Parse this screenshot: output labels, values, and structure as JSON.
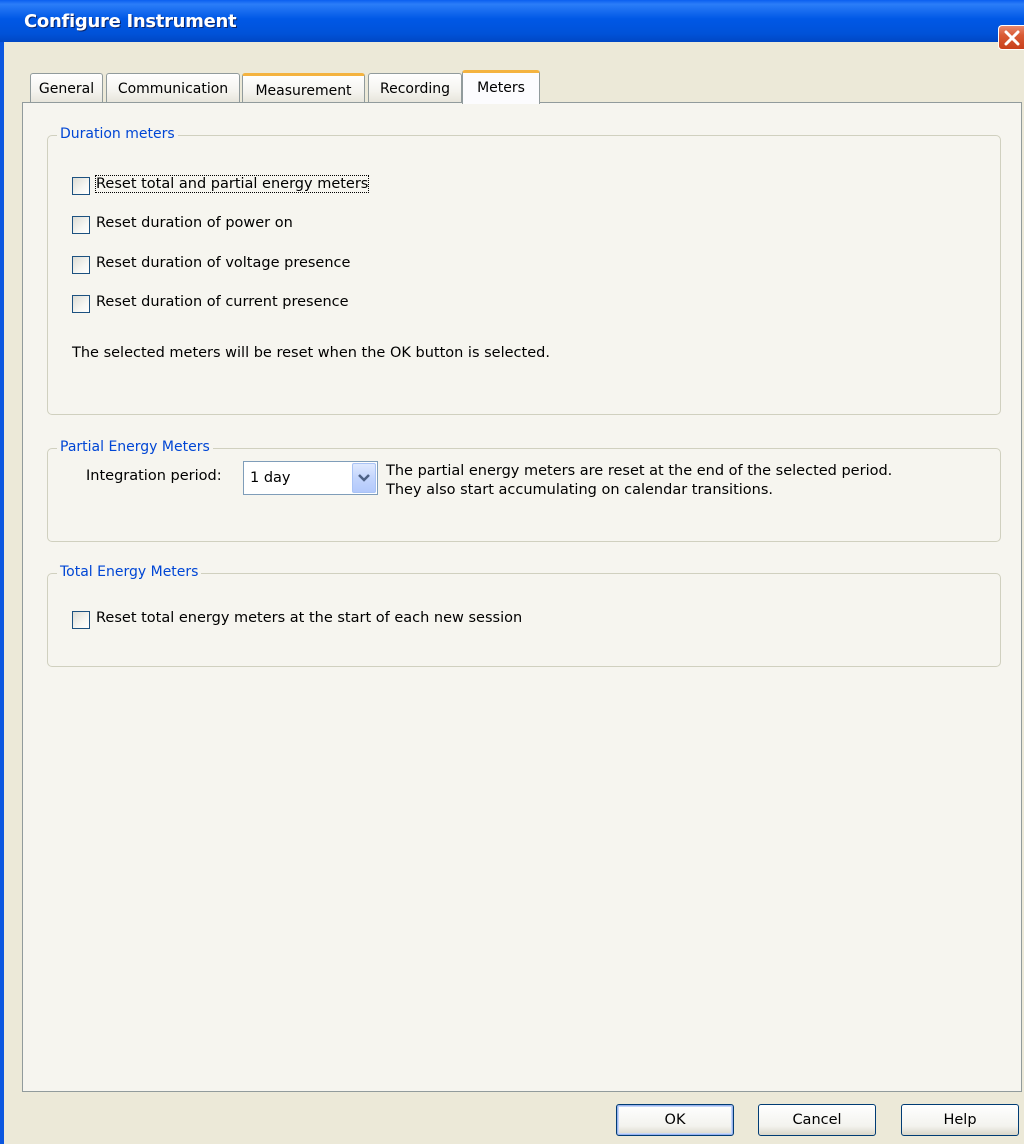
{
  "window": {
    "title": "Configure Instrument"
  },
  "tabs": [
    {
      "label": "General"
    },
    {
      "label": "Communication"
    },
    {
      "label": "Measurement"
    },
    {
      "label": "Recording"
    },
    {
      "label": "Meters",
      "active": true
    }
  ],
  "duration_meters": {
    "legend": "Duration meters",
    "checkboxes": [
      {
        "label": "Reset total and partial energy meters",
        "checked": false
      },
      {
        "label": "Reset duration of power on",
        "checked": false
      },
      {
        "label": "Reset duration of voltage presence",
        "checked": false
      },
      {
        "label": "Reset duration of current presence",
        "checked": false
      }
    ],
    "note": "The selected meters will be reset when the OK button is selected."
  },
  "partial_energy": {
    "legend": "Partial Energy Meters",
    "label": "Integration period:",
    "selected": "1 day",
    "description_line1": "The partial energy meters are reset at the end of the selected period.",
    "description_line2": "They also start accumulating on calendar transitions."
  },
  "total_energy": {
    "legend": "Total Energy Meters",
    "checkbox_label": "Reset total energy meters at the start of each new session",
    "checked": false
  },
  "buttons": {
    "ok": "OK",
    "cancel": "Cancel",
    "help": "Help"
  },
  "colors": {
    "titlebar": "#0058e6",
    "legend_text": "#0046d5",
    "tab_highlight": "#f4b33f"
  }
}
